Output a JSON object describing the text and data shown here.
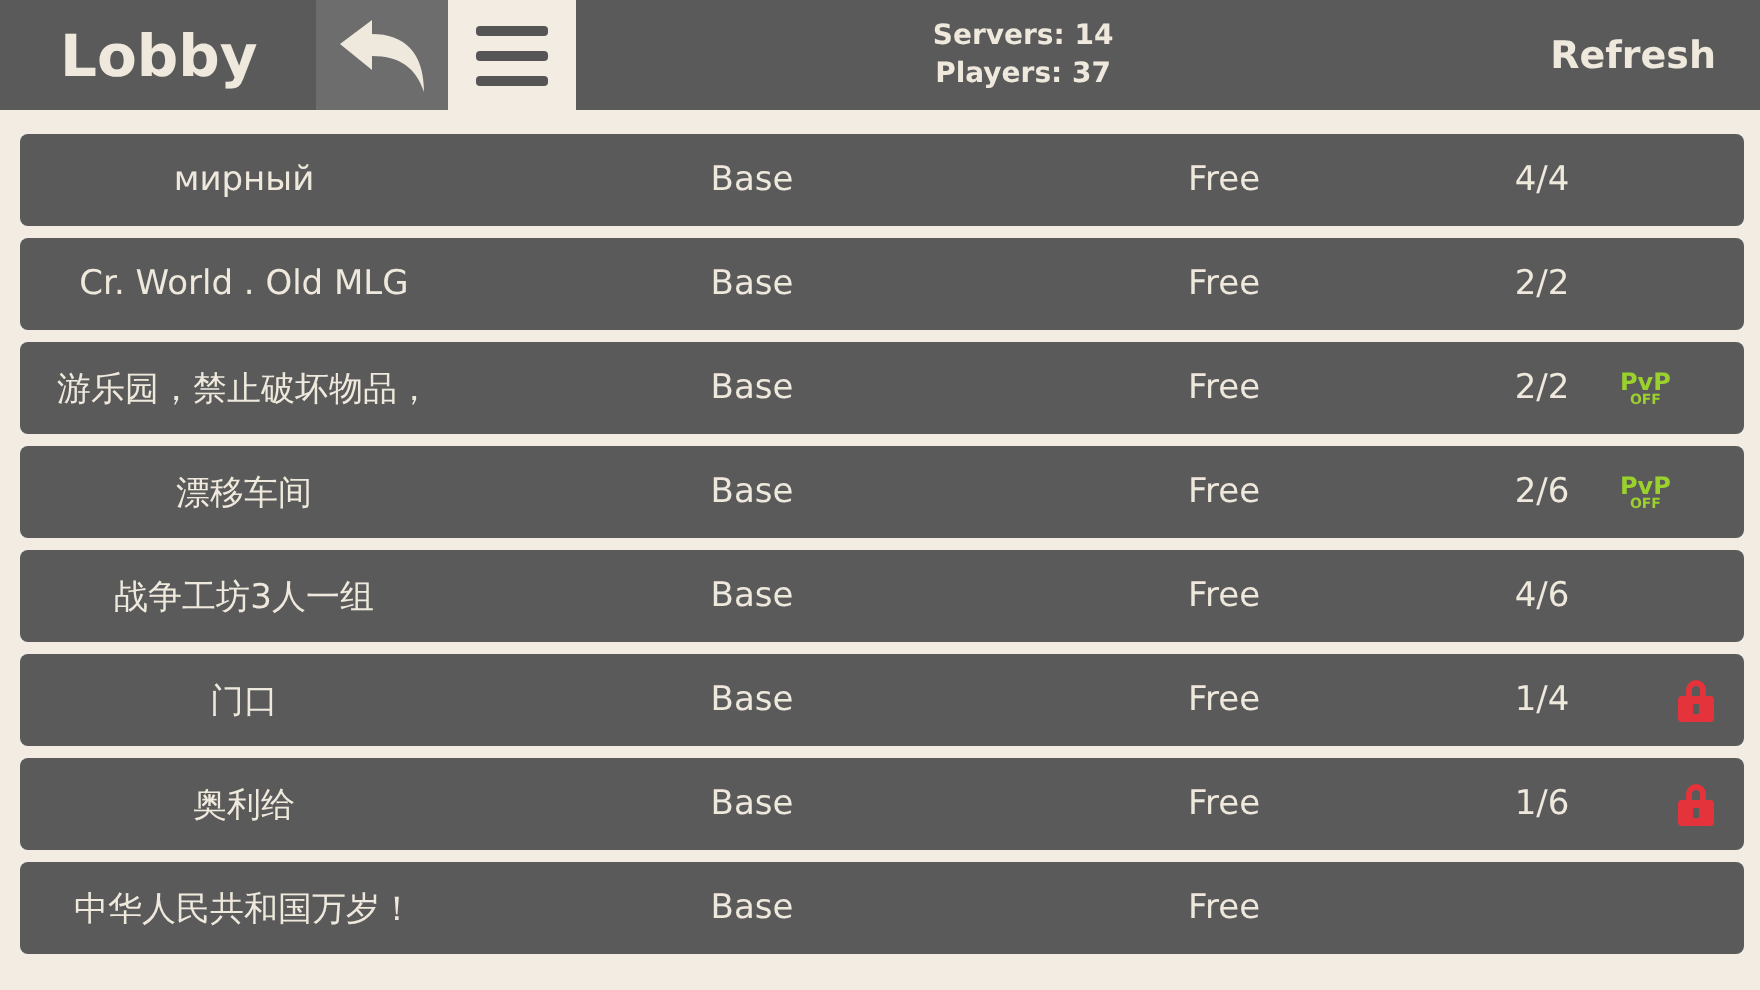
{
  "header": {
    "title": "Lobby",
    "servers": "Servers: 14",
    "players": "Players: 37",
    "refresh": "Refresh"
  },
  "rows": [
    {
      "name": "мирный",
      "mode": "Base",
      "price": "Free",
      "count": "4/4",
      "badge": {
        "kind": "none"
      }
    },
    {
      "name": "Cr. World . Old MLG",
      "mode": "Base",
      "price": "Free",
      "count": "2/2",
      "badge": {
        "kind": "none"
      }
    },
    {
      "name": "游乐园，禁止破坏物品，",
      "mode": "Base",
      "price": "Free",
      "count": "2/2",
      "badge": {
        "kind": "pvp",
        "top": "PvP",
        "bottom": "OFF"
      }
    },
    {
      "name": "漂移车间",
      "mode": "Base",
      "price": "Free",
      "count": "2/6",
      "badge": {
        "kind": "pvp",
        "top": "PvP",
        "bottom": "OFF"
      }
    },
    {
      "name": "战争工坊3人一组",
      "mode": "Base",
      "price": "Free",
      "count": "4/6",
      "badge": {
        "kind": "none"
      }
    },
    {
      "name": "门口",
      "mode": "Base",
      "price": "Free",
      "count": "1/4",
      "badge": {
        "kind": "lock"
      }
    },
    {
      "name": "奥利给",
      "mode": "Base",
      "price": "Free",
      "count": "1/6",
      "badge": {
        "kind": "lock"
      }
    },
    {
      "name": "中华人民共和国万岁！",
      "mode": "Base",
      "price": "Free",
      "badge": {
        "kind": "none"
      }
    }
  ]
}
